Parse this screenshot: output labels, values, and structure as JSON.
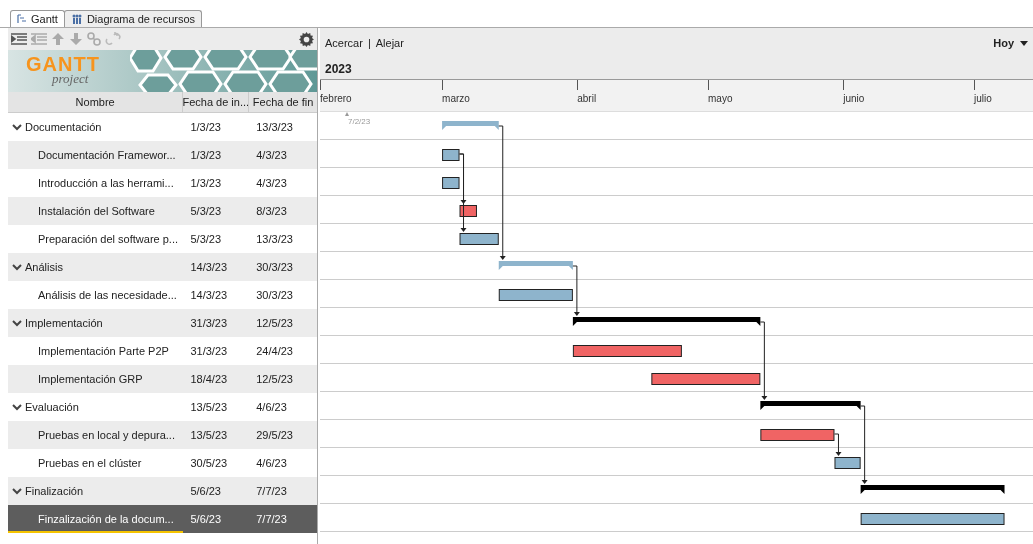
{
  "tabs": [
    {
      "label": "Gantt",
      "selected": true
    },
    {
      "label": "Diagrama de recursos",
      "selected": false
    }
  ],
  "logo": {
    "title": "GANTT",
    "subtitle": "project"
  },
  "columns": [
    "Nombre",
    "Fecha de in...",
    "Fecha de fin"
  ],
  "chart_toolbar": {
    "zoom_in": "Acercar",
    "separator": "|",
    "zoom_out": "Alejar",
    "today": "Hoy",
    "year": "2023"
  },
  "months": [
    "febrero",
    "marzo",
    "abril",
    "mayo",
    "junio",
    "julio"
  ],
  "marker": {
    "label": "7/2/23"
  },
  "tasks": [
    {
      "name": "Documentación",
      "start": "1/3/23",
      "end": "13/3/23",
      "expanded": true,
      "selected": false,
      "has_successor": true,
      "color": "#8eb4cc",
      "children": [
        {
          "name": "Documentación Framewor...",
          "start": "1/3/23",
          "end": "4/3/23",
          "selected": false,
          "has_successor": true,
          "color": "#8eb4cc"
        },
        {
          "name": "Introducción a las herrami...",
          "start": "1/3/23",
          "end": "4/3/23",
          "selected": false,
          "has_successor": false,
          "color": "#8eb4cc"
        },
        {
          "name": "Instalación del Software",
          "start": "5/3/23",
          "end": "8/3/23",
          "selected": false,
          "has_successor": false,
          "color": "#f06464"
        },
        {
          "name": "Preparación del software p...",
          "start": "5/3/23",
          "end": "13/3/23",
          "selected": false,
          "has_successor": false,
          "color": "#8eb4cc"
        }
      ]
    },
    {
      "name": "Análisis",
      "start": "14/3/23",
      "end": "30/3/23",
      "expanded": true,
      "selected": false,
      "has_successor": true,
      "color": "#8eb4cc",
      "children": [
        {
          "name": "Análisis de las necesidade...",
          "start": "14/3/23",
          "end": "30/3/23",
          "selected": false,
          "color": "#8eb4cc"
        }
      ]
    },
    {
      "name": "Implementación",
      "start": "31/3/23",
      "end": "12/5/23",
      "expanded": true,
      "selected": false,
      "has_successor": true,
      "color": "#000000",
      "children": [
        {
          "name": "Implementación Parte P2P",
          "start": "31/3/23",
          "end": "24/4/23",
          "selected": false,
          "color": "#f06464"
        },
        {
          "name": "Implementación GRP",
          "start": "18/4/23",
          "end": "12/5/23",
          "selected": false,
          "color": "#f06464"
        }
      ]
    },
    {
      "name": "Evaluación",
      "start": "13/5/23",
      "end": "4/6/23",
      "expanded": true,
      "selected": false,
      "has_successor": true,
      "color": "#000000",
      "children": [
        {
          "name": "Pruebas en local y depura...",
          "start": "13/5/23",
          "end": "29/5/23",
          "selected": false,
          "has_successor": true,
          "color": "#f06464"
        },
        {
          "name": "Pruebas en el clúster",
          "start": "30/5/23",
          "end": "4/6/23",
          "selected": false,
          "color": "#8eb4cc"
        }
      ]
    },
    {
      "name": "Finalización",
      "start": "5/6/23",
      "end": "7/7/23",
      "expanded": true,
      "selected": false,
      "color": "#000000",
      "children": [
        {
          "name": "Finzalización de la docum...",
          "start": "5/6/23",
          "end": "7/7/23",
          "selected": true,
          "color": "#8eb4cc"
        }
      ]
    }
  ]
}
